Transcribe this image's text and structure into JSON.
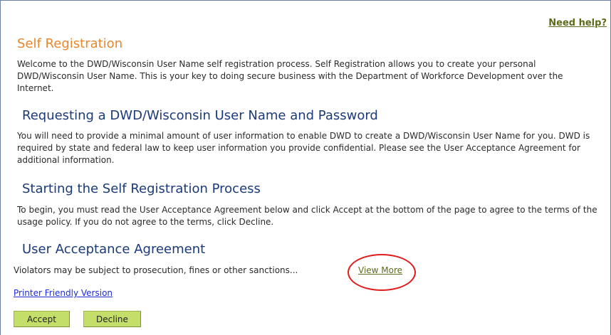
{
  "header": {
    "help_link": "Need help?"
  },
  "sections": {
    "self_registration": {
      "title": "Self Registration",
      "body": "Welcome to the DWD/Wisconsin User Name self registration process. Self Registration allows you to create your personal DWD/Wisconsin User Name. This is your key to doing secure business with the Department of Workforce Development over the Internet."
    },
    "requesting": {
      "title": "Requesting a DWD/Wisconsin User Name and Password",
      "body": "You will need to provide a minimal amount of user information to enable DWD to create a DWD/Wisconsin User Name for you. DWD is required by state and federal law to keep user information you provide confidential. Please see the User Acceptance Agreement for additional information."
    },
    "starting": {
      "title": "Starting the Self Registration Process",
      "body": "To begin, you must read the User Acceptance Agreement below and click Accept at the bottom of the page to agree to the terms of the usage policy. If you do not agree to the terms, click Decline."
    },
    "agreement": {
      "title": "User Acceptance Agreement",
      "body": "Violators may be subject to prosecution, fines or other sanctions...",
      "view_more": "View More"
    }
  },
  "links": {
    "printer_friendly": "Printer Friendly Version"
  },
  "buttons": {
    "accept": "Accept",
    "decline": "Decline"
  },
  "colors": {
    "orange_heading": "#e8872c",
    "blue_heading": "#1b3a78",
    "button_green": "#c4de6a",
    "annotation_circle": "#e01c1c"
  }
}
